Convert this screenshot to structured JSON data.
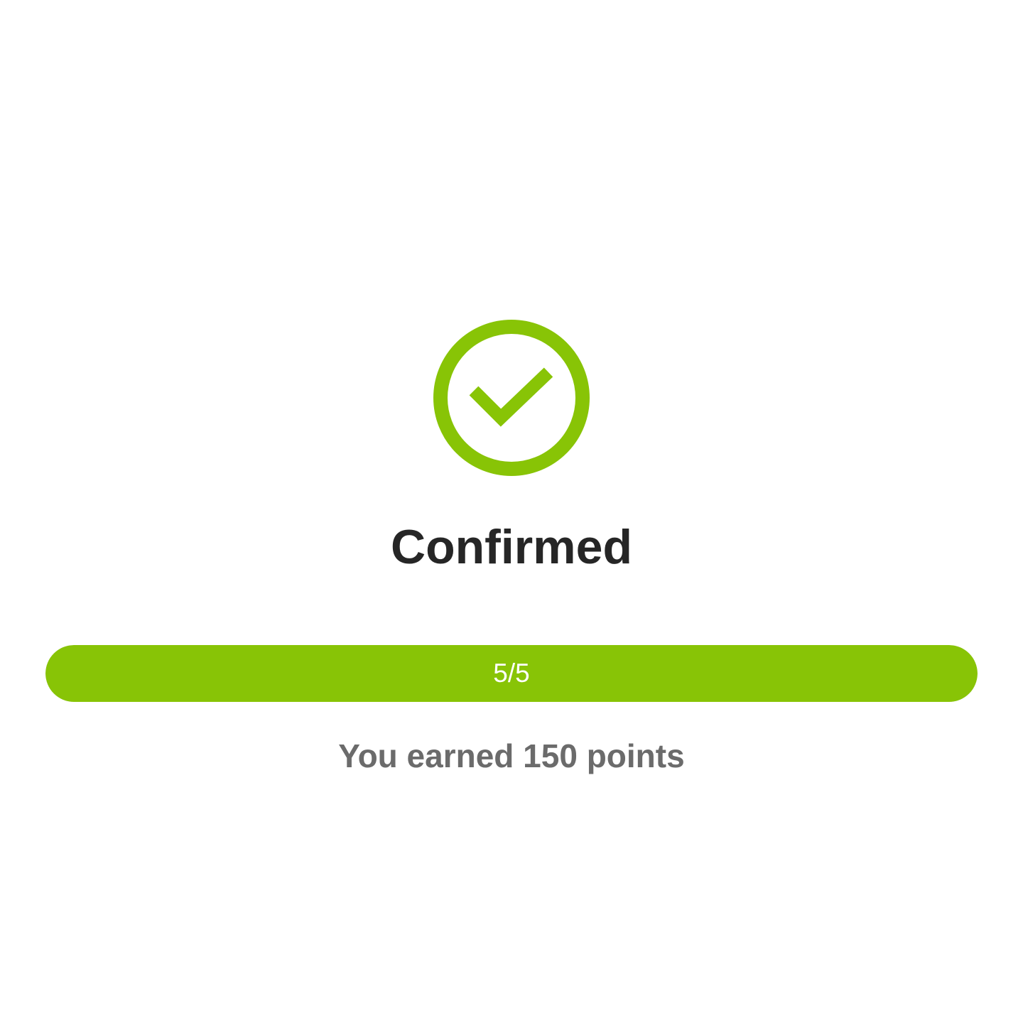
{
  "status": {
    "icon": "check-circle-icon",
    "title": "Confirmed"
  },
  "progress": {
    "current": 5,
    "total": 5,
    "label": "5/5"
  },
  "message": "You earned 150 points",
  "colors": {
    "accent": "#88c406",
    "title": "#262626",
    "subtitle": "#6b6b6b",
    "track": "#e9e9e9"
  }
}
